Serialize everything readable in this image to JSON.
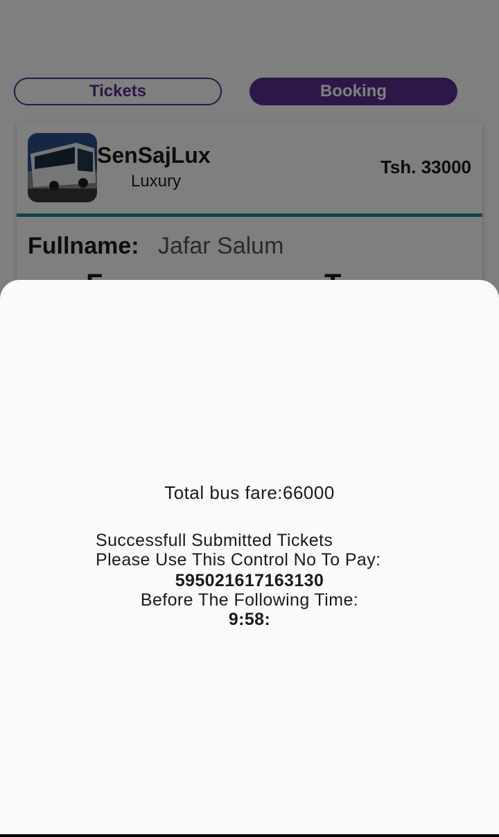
{
  "tabs": {
    "tickets_label": "Tickets",
    "booking_label": "Booking"
  },
  "bus_card": {
    "company": "SenSajLux",
    "class": "Luxury",
    "price": "Tsh. 33000",
    "field_label": "Fullname:",
    "field_value": "Jafar Salum",
    "partial_left": "F",
    "partial_right": "T"
  },
  "sheet": {
    "total_fare": "Total bus fare:66000",
    "line1": "Successfull Submitted Tickets",
    "line2": "Please Use This Control No To Pay:",
    "control_no": "595021617163130",
    "line3": "Before The Following Time:",
    "time": "9:58:"
  },
  "colors": {
    "accent_purple": "#5b2e91",
    "divider_teal": "#1f8b99"
  }
}
